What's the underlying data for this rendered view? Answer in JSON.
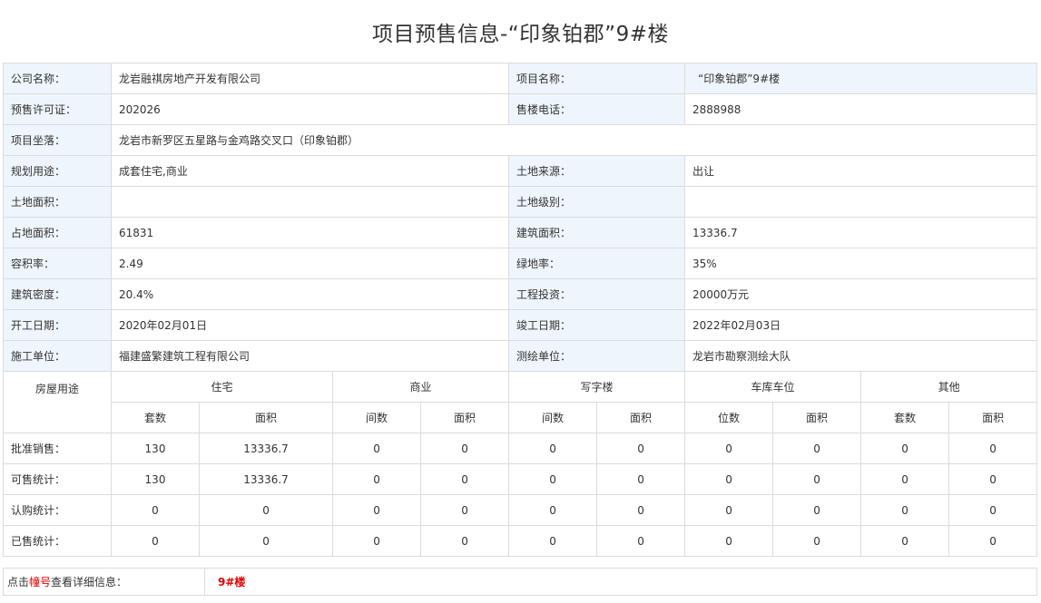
{
  "title": "项目预售信息-“印象铂郡”9#楼",
  "info": {
    "company_label": "公司名称：",
    "company": "龙岩融祺房地产开发有限公司",
    "project_label": "项目名称：",
    "project": "“印象铂郡”9#楼",
    "permit_label": "预售许可证：",
    "permit": "202026",
    "phone_label": "售楼电话：",
    "phone": "2888988",
    "location_label": "项目坐落：",
    "location": "龙岩市新罗区五星路与金鸡路交叉口（印象铂郡）",
    "usage_label": "规划用途：",
    "usage": "成套住宅,商业",
    "land_source_label": "土地来源：",
    "land_source": "出让",
    "land_area_label": "土地面积：",
    "land_area": "",
    "land_grade_label": "土地级别：",
    "land_grade": "",
    "occupied_area_label": "占地面积：",
    "occupied_area": "61831",
    "building_area_label": "建筑面积：",
    "building_area": "13336.7",
    "plot_ratio_label": "容积率：",
    "plot_ratio": "2.49",
    "green_ratio_label": "绿地率：",
    "green_ratio": "35%",
    "density_label": "建筑密度：",
    "density": "20.4%",
    "investment_label": "工程投资：",
    "investment": "20000万元",
    "start_date_label": "开工日期：",
    "start_date": "2020年02月01日",
    "end_date_label": "竣工日期：",
    "end_date": "2022年02月03日",
    "constructor_label": "施工单位：",
    "constructor": "福建盛繁建筑工程有限公司",
    "surveyor_label": "测绘单位：",
    "surveyor": "龙岩市勘察测绘大队"
  },
  "stats": {
    "corner": "房屋用途",
    "categories": [
      "住宅",
      "商业",
      "写字楼",
      "车库车位",
      "其他"
    ],
    "subheaders": [
      "套数",
      "面积",
      "间数",
      "面积",
      "间数",
      "面积",
      "位数",
      "面积",
      "套数",
      "面积"
    ],
    "rows": [
      {
        "label": "批准销售：",
        "values": [
          "130",
          "13336.7",
          "0",
          "0",
          "0",
          "0",
          "0",
          "0",
          "0",
          "0"
        ]
      },
      {
        "label": "可售统计：",
        "values": [
          "130",
          "13336.7",
          "0",
          "0",
          "0",
          "0",
          "0",
          "0",
          "0",
          "0"
        ]
      },
      {
        "label": "认购统计：",
        "values": [
          "0",
          "0",
          "0",
          "0",
          "0",
          "0",
          "0",
          "0",
          "0",
          "0"
        ]
      },
      {
        "label": "已售统计：",
        "values": [
          "0",
          "0",
          "0",
          "0",
          "0",
          "0",
          "0",
          "0",
          "0",
          "0"
        ]
      }
    ]
  },
  "footer": {
    "prefix": "点击",
    "highlight": "幢号",
    "suffix": "查看详细信息：",
    "building_link": "9#楼"
  }
}
